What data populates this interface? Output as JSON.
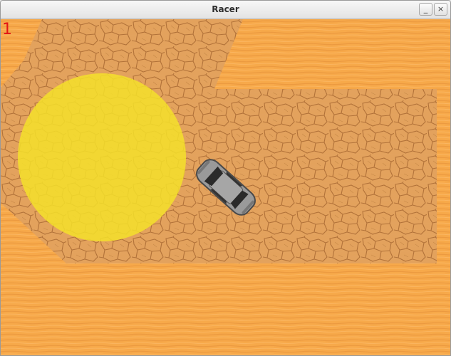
{
  "window": {
    "title": "Racer",
    "minimize_glyph": "_",
    "close_glyph": "×"
  },
  "hud": {
    "score": "1"
  },
  "colors": {
    "sand": "#f7a94a",
    "sand_stripe": "#e9953a",
    "cracked_ground": "#e3a461",
    "crack_line": "#b0713a",
    "checkpoint": "#f4e12a",
    "car_body": "#9a9a9a",
    "car_outline": "#4a4a4a",
    "car_glass": "#2a2a2a",
    "score_color": "#e21515"
  },
  "scene": {
    "checkpoint_icon": "checkpoint-circle",
    "car_icon": "car-top-view-icon"
  }
}
